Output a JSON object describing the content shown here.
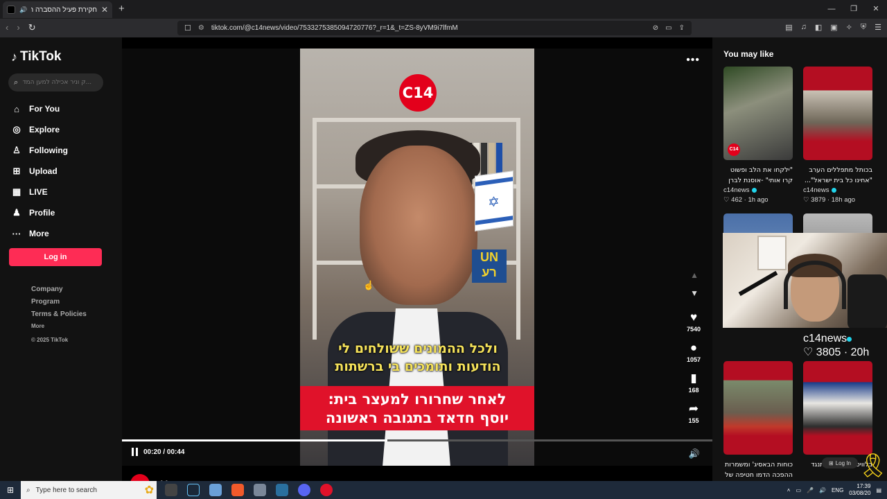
{
  "browser": {
    "tab_title": "חקירת פעיל ההסברה חדאד: ...",
    "url": "tiktok.com/@c14news/video/7533275385094720776?_r=1&_t=ZS-8yVM9i7lfmM",
    "new_tab": "+",
    "close_tab": "✕"
  },
  "sidebar": {
    "logo": "TikTok",
    "search_placeholder": "...ק וניר אכילה למען המדינה",
    "nav": [
      {
        "label": "For You",
        "icon": "home-icon"
      },
      {
        "label": "Explore",
        "icon": "compass-icon"
      },
      {
        "label": "Following",
        "icon": "following-icon"
      },
      {
        "label": "Upload",
        "icon": "upload-icon"
      },
      {
        "label": "LIVE",
        "icon": "live-icon"
      },
      {
        "label": "Profile",
        "icon": "profile-icon"
      },
      {
        "label": "More",
        "icon": "more-icon"
      }
    ],
    "login": "Log in",
    "footer": {
      "company": "Company",
      "program": "Program",
      "terms": "Terms & Policies",
      "more": "More",
      "copyright": "© 2025 TikTok"
    }
  },
  "video": {
    "channel_logo": "C14",
    "caption_line1": "ולכל ההמונים ששולחים לי",
    "caption_line2": "הודעות ותומכים בי ברשתות",
    "banner_line1": "לאחר שחרורו למעצר בית:",
    "banner_line2": "יוסף חדאד בתגובה ראשונה",
    "flag_sign": "UN",
    "flag_sign2": "רע",
    "time": "00:20 / 00:44",
    "progress": 0.45,
    "author": "c14news",
    "likes": "7540",
    "comments": "1057",
    "saves": "168",
    "shares": "155"
  },
  "suggestions": {
    "title": "You may like",
    "cards": [
      {
        "title": "\"ילקחו את הלב ופשוט קרו אותי\" -אוסנת לברן",
        "author": "c14news",
        "likes": "462",
        "age": "1h ago"
      },
      {
        "title": "בכותל מתפללים הערב \"אחינו כל בית ישראל\"...",
        "author": "c14news",
        "likes": "3879",
        "age": "18h ago"
      },
      {
        "author": "c14news",
        "likes": "3805",
        "age": "20h ago"
      },
      {
        "title": "כוחות הבאסיג' ומשמרות ההפכה הדמו חטיפה של",
        "author": ""
      },
      {
        "title": "בלוויט: \"הנשיא מתנגד",
        "author": ""
      }
    ],
    "login_small": "Log In"
  },
  "taskbar": {
    "search": "Type here to search",
    "lang": "ENG",
    "time": "17:39",
    "date": "03/08/20"
  }
}
